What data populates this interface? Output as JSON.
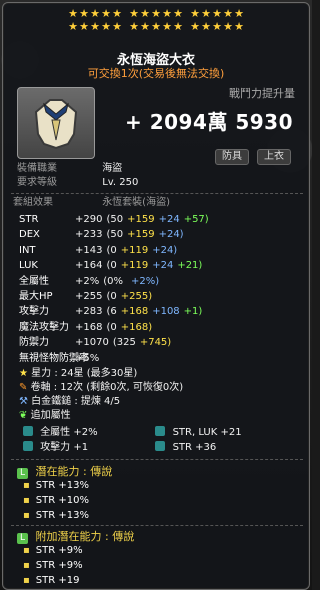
{
  "stars": {
    "row1_count": 15,
    "row2_count": 15
  },
  "item": {
    "name": "永恆海盜大衣",
    "trade_status": "可交換1次(交易後無法交換)",
    "power_label": "戰鬥力提升量",
    "power_value": "+ 2094萬 5930",
    "tags": [
      "防具",
      "上衣"
    ]
  },
  "requirements": {
    "job_label": "裝備職業",
    "job_value": "海盜",
    "level_label": "要求等級",
    "level_value": "Lv. 250"
  },
  "set_effect": {
    "label": "套組效果",
    "name": "永恆套裝(海盜)"
  },
  "stats": [
    {
      "name": "STR",
      "total": "+290",
      "open": "(50",
      "a": "+159",
      "b": "+24",
      "c": "+57)"
    },
    {
      "name": "DEX",
      "total": "+233",
      "open": "(50",
      "a": "+159",
      "b": "+24)",
      "c": ""
    },
    {
      "name": "INT",
      "total": "+143",
      "open": "(0",
      "a": "+119",
      "b": "+24)",
      "c": ""
    },
    {
      "name": "LUK",
      "total": "+164",
      "open": "(0",
      "a": "+119",
      "b": "+24",
      "c": "+21)"
    },
    {
      "name": "全屬性",
      "total": "+2%",
      "open": "(0%",
      "a": "",
      "b": "+2%)",
      "c": ""
    },
    {
      "name": "最大HP",
      "total": "+255",
      "open": "(0",
      "a": "+255)",
      "b": "",
      "c": ""
    },
    {
      "name": "攻擊力",
      "total": "+283",
      "open": "(6",
      "a": "+168",
      "b": "+108",
      "c": "+1)"
    },
    {
      "name": "魔法攻擊力",
      "total": "+168",
      "open": "(0",
      "a": "+168)",
      "b": "",
      "c": ""
    },
    {
      "name": "防禦力",
      "total": "+1070",
      "open": "(325",
      "a": "+745)",
      "b": "",
      "c": ""
    },
    {
      "name": "無視怪物防禦率",
      "total": "+5%",
      "open": "",
      "a": "",
      "b": "",
      "c": ""
    }
  ],
  "enhance": {
    "star_line": "星力 : 24星 (最多30星)",
    "scroll_line": "卷軸 : 12次 (剩餘0次, 可恢復0次)",
    "hammer_line": "白金鐵鎚 : 提煉 4/5",
    "extra_head": "追加屬性"
  },
  "extra_stats": [
    {
      "left": "全屬性 +2%",
      "right": "STR, LUK +21"
    },
    {
      "left": "攻擊力 +1",
      "right": "STR +36"
    }
  ],
  "potential": {
    "head_label": "潛在能力 : ",
    "head_grade": "傳說",
    "lines": [
      "STR +13%",
      "STR +10%",
      "STR +13%"
    ]
  },
  "bonus_potential": {
    "head_label": "附加潛在能力 : ",
    "head_grade": "傳說",
    "lines": [
      "STR +9%",
      "STR +9%",
      "STR +19"
    ]
  },
  "colors": {
    "star": "#ffcf3a",
    "orange": "#ff9a2b",
    "yellow": "#ffe24a",
    "blue": "#7fb7ff",
    "green": "#7cff5a"
  }
}
